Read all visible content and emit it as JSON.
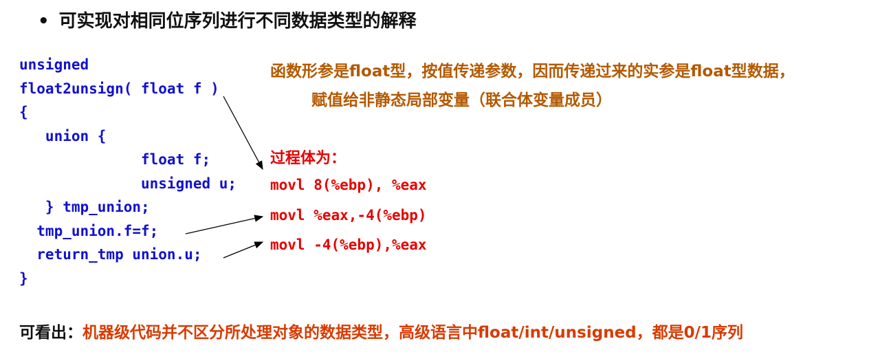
{
  "title": {
    "bullet": "•",
    "text": "可实现对相同位序列进行不同数据类型的解释"
  },
  "code_lines": [
    "unsigned",
    "float2unsign( float f )",
    "{",
    "   union {",
    "              float f;",
    "              unsigned u;",
    "   } tmp_union;",
    "  tmp_union.f=f;",
    "  return_tmp union.u;",
    "}"
  ],
  "note": {
    "line1": "函数形参是float型，按值传递参数，因而传递过来的实参是float型数据，",
    "line2": "赋值给非静态局部变量（联合体变量成员）"
  },
  "procedure": {
    "label": "过程体为：",
    "asm": [
      "movl 8(%ebp), %eax",
      "movl %eax,-4(%ebp)",
      "movl -4(%ebp),%eax"
    ]
  },
  "conclusion": {
    "label": "可看出：",
    "text": "机器级代码并不区分所处理对象的数据类型，高级语言中float/int/unsigned，都是0/1序列"
  },
  "colors": {
    "code": "#1010d0",
    "asm": "#e60000",
    "note": "#b35900",
    "conclusion": "#d83b01"
  }
}
